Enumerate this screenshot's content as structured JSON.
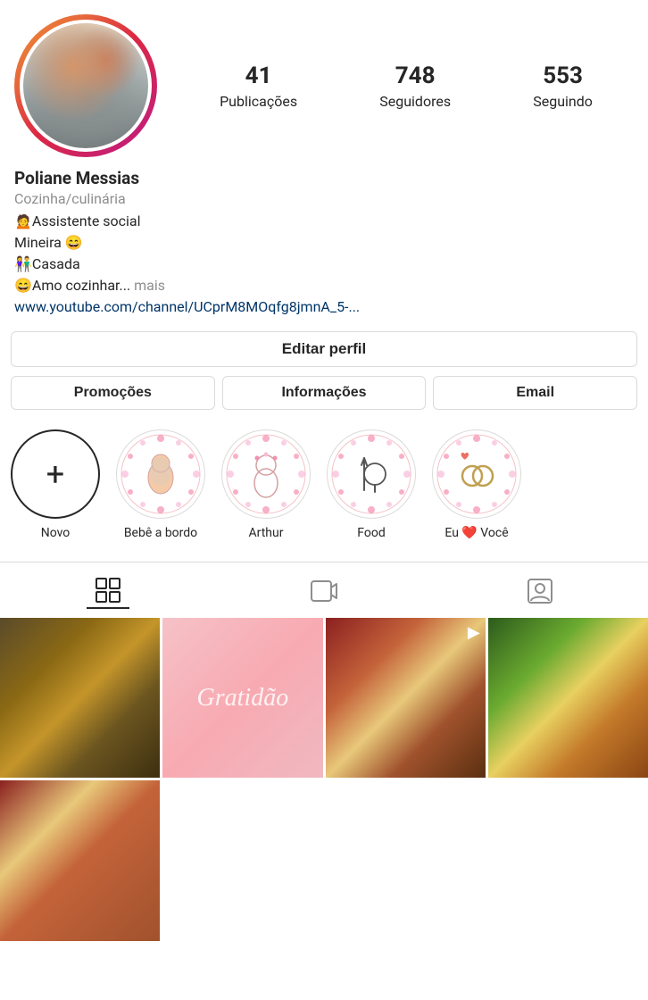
{
  "profile": {
    "name": "Poliane Messias",
    "category": "Cozinha/culinária",
    "bio_lines": [
      "🙍Assistente social",
      "Mineira 😄",
      "👫Casada",
      "😄Amo cozinhar..."
    ],
    "bio_more": "mais",
    "link": "www.youtube.com/channel/UCprM8MOqfg8jmnA_5-...",
    "stats": {
      "posts": "41",
      "posts_label": "Publicações",
      "followers": "748",
      "followers_label": "Seguidores",
      "following": "553",
      "following_label": "Seguindo"
    }
  },
  "buttons": {
    "edit_profile": "Editar perfil",
    "promotions": "Promoções",
    "informacoes": "Informações",
    "email": "Email"
  },
  "highlights": [
    {
      "label": "Novo",
      "type": "new"
    },
    {
      "label": "Bebê a bordo",
      "type": "story"
    },
    {
      "label": "Arthur",
      "type": "story"
    },
    {
      "label": "Food",
      "type": "story"
    },
    {
      "label": "Eu ❤️ Você",
      "type": "story"
    }
  ],
  "tabs": [
    {
      "name": "grid",
      "active": true
    },
    {
      "name": "video",
      "active": false
    },
    {
      "name": "tagged",
      "active": false
    }
  ],
  "gratidao_text": "Gratidão",
  "icons": {
    "plus": "+",
    "grid": "grid-icon",
    "video": "video-icon",
    "person": "person-icon"
  }
}
